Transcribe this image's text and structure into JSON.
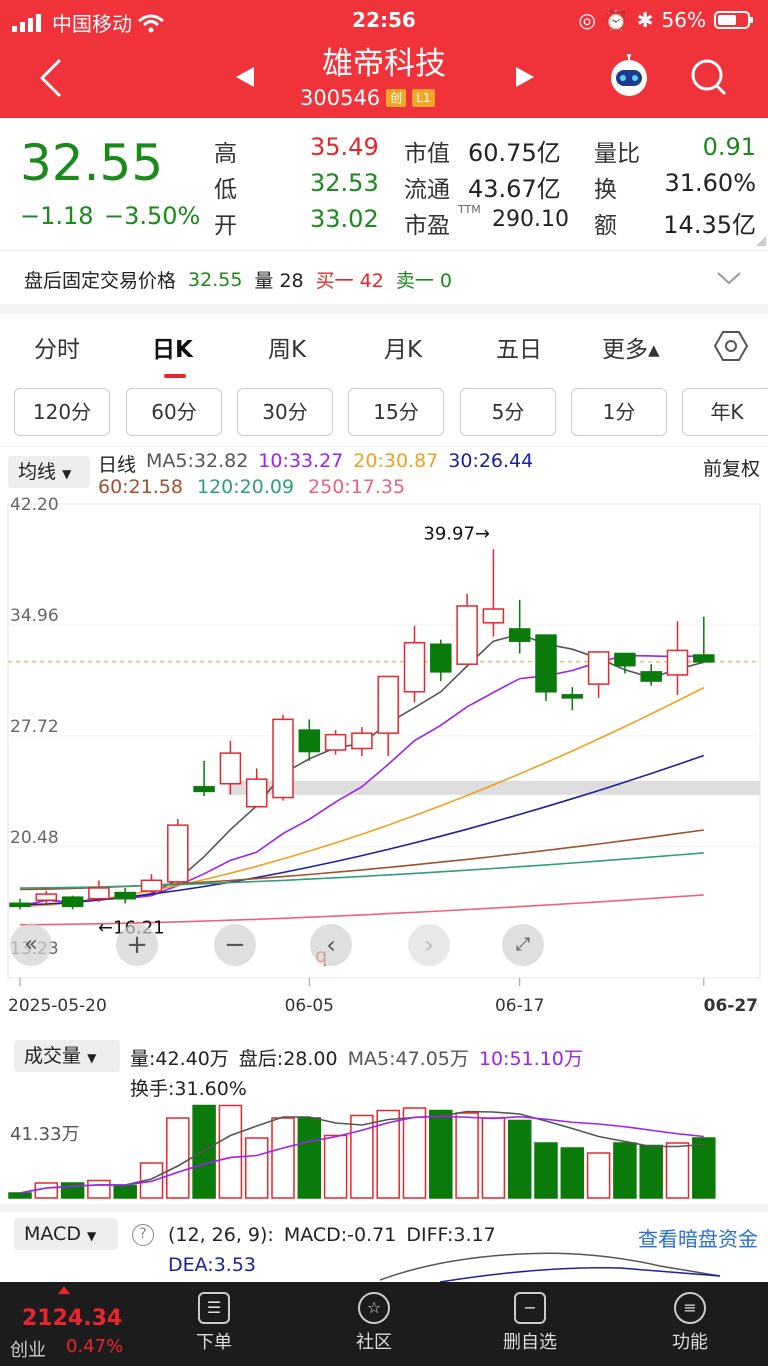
{
  "status": {
    "carrier": "中国移动",
    "time": "22:56",
    "battery": "56%"
  },
  "stock": {
    "name": "雄帝科技",
    "code": "300546",
    "board_tag": "创",
    "level_tag": "L1",
    "price": "32.55",
    "change": "−1.18",
    "change_pct": "−3.50%"
  },
  "quote": {
    "high_label": "高",
    "high": "35.49",
    "low_label": "低",
    "low": "32.53",
    "open_label": "开",
    "open": "33.02",
    "mcap_label": "市值",
    "mcap": "60.75亿",
    "float_label": "流通",
    "float": "43.67亿",
    "pe_label": "市盈",
    "pe_sup": "TTM",
    "pe": "290.10",
    "vr_label": "量比",
    "vr": "0.91",
    "turn_label": "换",
    "turn": "31.60%",
    "amt_label": "额",
    "amt": "14.35亿"
  },
  "after": {
    "label": "盘后固定交易价格",
    "price": "32.55",
    "vol_label": "量 28",
    "buy": "买一 42",
    "sell": "卖一 0"
  },
  "tabs": [
    "分时",
    "日K",
    "周K",
    "月K",
    "五日",
    "更多▴"
  ],
  "periods": [
    "120分",
    "60分",
    "30分",
    "15分",
    "5分",
    "1分",
    "年K"
  ],
  "ma": {
    "mode": "均线",
    "kind": "日线",
    "ma5": "MA5:32.82",
    "ma10": "10:33.27",
    "ma20": "20:30.87",
    "ma30": "30:26.44",
    "ma60": "60:21.58",
    "ma120": "120:20.09",
    "ma250": "250:17.35",
    "adjust": "前复权"
  },
  "axis": {
    "y": [
      "42.20",
      "34.96",
      "27.72",
      "20.48",
      "13.23"
    ],
    "x": [
      "2025-05-20",
      "06-05",
      "06-17",
      "06-27"
    ],
    "high_mark": "39.97→",
    "low_mark": "←16.21",
    "event": "q"
  },
  "chart_data": {
    "type": "candlestick",
    "x_start": "2025-05-20",
    "x_end": "06-27",
    "ylim": [
      13.23,
      42.2
    ],
    "candles": [
      [
        16.8,
        16.6,
        17.1,
        16.4
      ],
      [
        17.0,
        17.4,
        17.6,
        16.8
      ],
      [
        17.2,
        16.6,
        17.3,
        16.4
      ],
      [
        17.1,
        17.8,
        18.3,
        16.9
      ],
      [
        17.5,
        17.1,
        17.8,
        16.8
      ],
      [
        17.6,
        18.3,
        18.7,
        17.4
      ],
      [
        18.2,
        21.9,
        22.3,
        18.0
      ],
      [
        24.4,
        24.1,
        26.1,
        23.8
      ],
      [
        24.6,
        26.6,
        27.4,
        23.9
      ],
      [
        23.1,
        24.9,
        25.6,
        23.1
      ],
      [
        23.7,
        28.8,
        29.1,
        23.5
      ],
      [
        28.1,
        26.7,
        28.8,
        26.1
      ],
      [
        26.8,
        27.8,
        28.1,
        26.5
      ],
      [
        26.9,
        27.9,
        28.3,
        26.4
      ],
      [
        27.9,
        31.6,
        31.6,
        26.4
      ],
      [
        30.6,
        33.8,
        34.9,
        29.9
      ],
      [
        33.7,
        31.9,
        34.0,
        31.3
      ],
      [
        32.4,
        36.2,
        37.0,
        32.4
      ],
      [
        35.1,
        36.0,
        39.9,
        34.2
      ],
      [
        34.7,
        33.9,
        36.6,
        33.1
      ],
      [
        34.3,
        30.6,
        34.3,
        30.0
      ],
      [
        30.4,
        30.2,
        30.9,
        29.4
      ],
      [
        31.1,
        33.2,
        33.2,
        30.2
      ],
      [
        33.1,
        32.3,
        33.1,
        31.8
      ],
      [
        31.9,
        31.3,
        32.4,
        31.0
      ],
      [
        31.7,
        33.3,
        35.2,
        30.4
      ],
      [
        33.0,
        32.55,
        35.5,
        32.5
      ]
    ]
  },
  "volume": {
    "label": "成交量",
    "vol": "量:42.40万",
    "after": "盘后:28.00",
    "ma5": "MA5:47.05万",
    "ma10": "10:51.10万",
    "turn": "换手:31.60%",
    "axis": "41.33万"
  },
  "macd": {
    "label": "MACD",
    "params": "(12, 26, 9):",
    "macd": "MACD:-0.71",
    "diff": "DIFF:3.17",
    "dea": "DEA:3.53",
    "link": "查看暗盘资金"
  },
  "bottom": {
    "index": "2124.34",
    "index_name": "创业",
    "index_pct": "0.47%",
    "items": [
      "下单",
      "社区",
      "删自选",
      "功能"
    ]
  }
}
